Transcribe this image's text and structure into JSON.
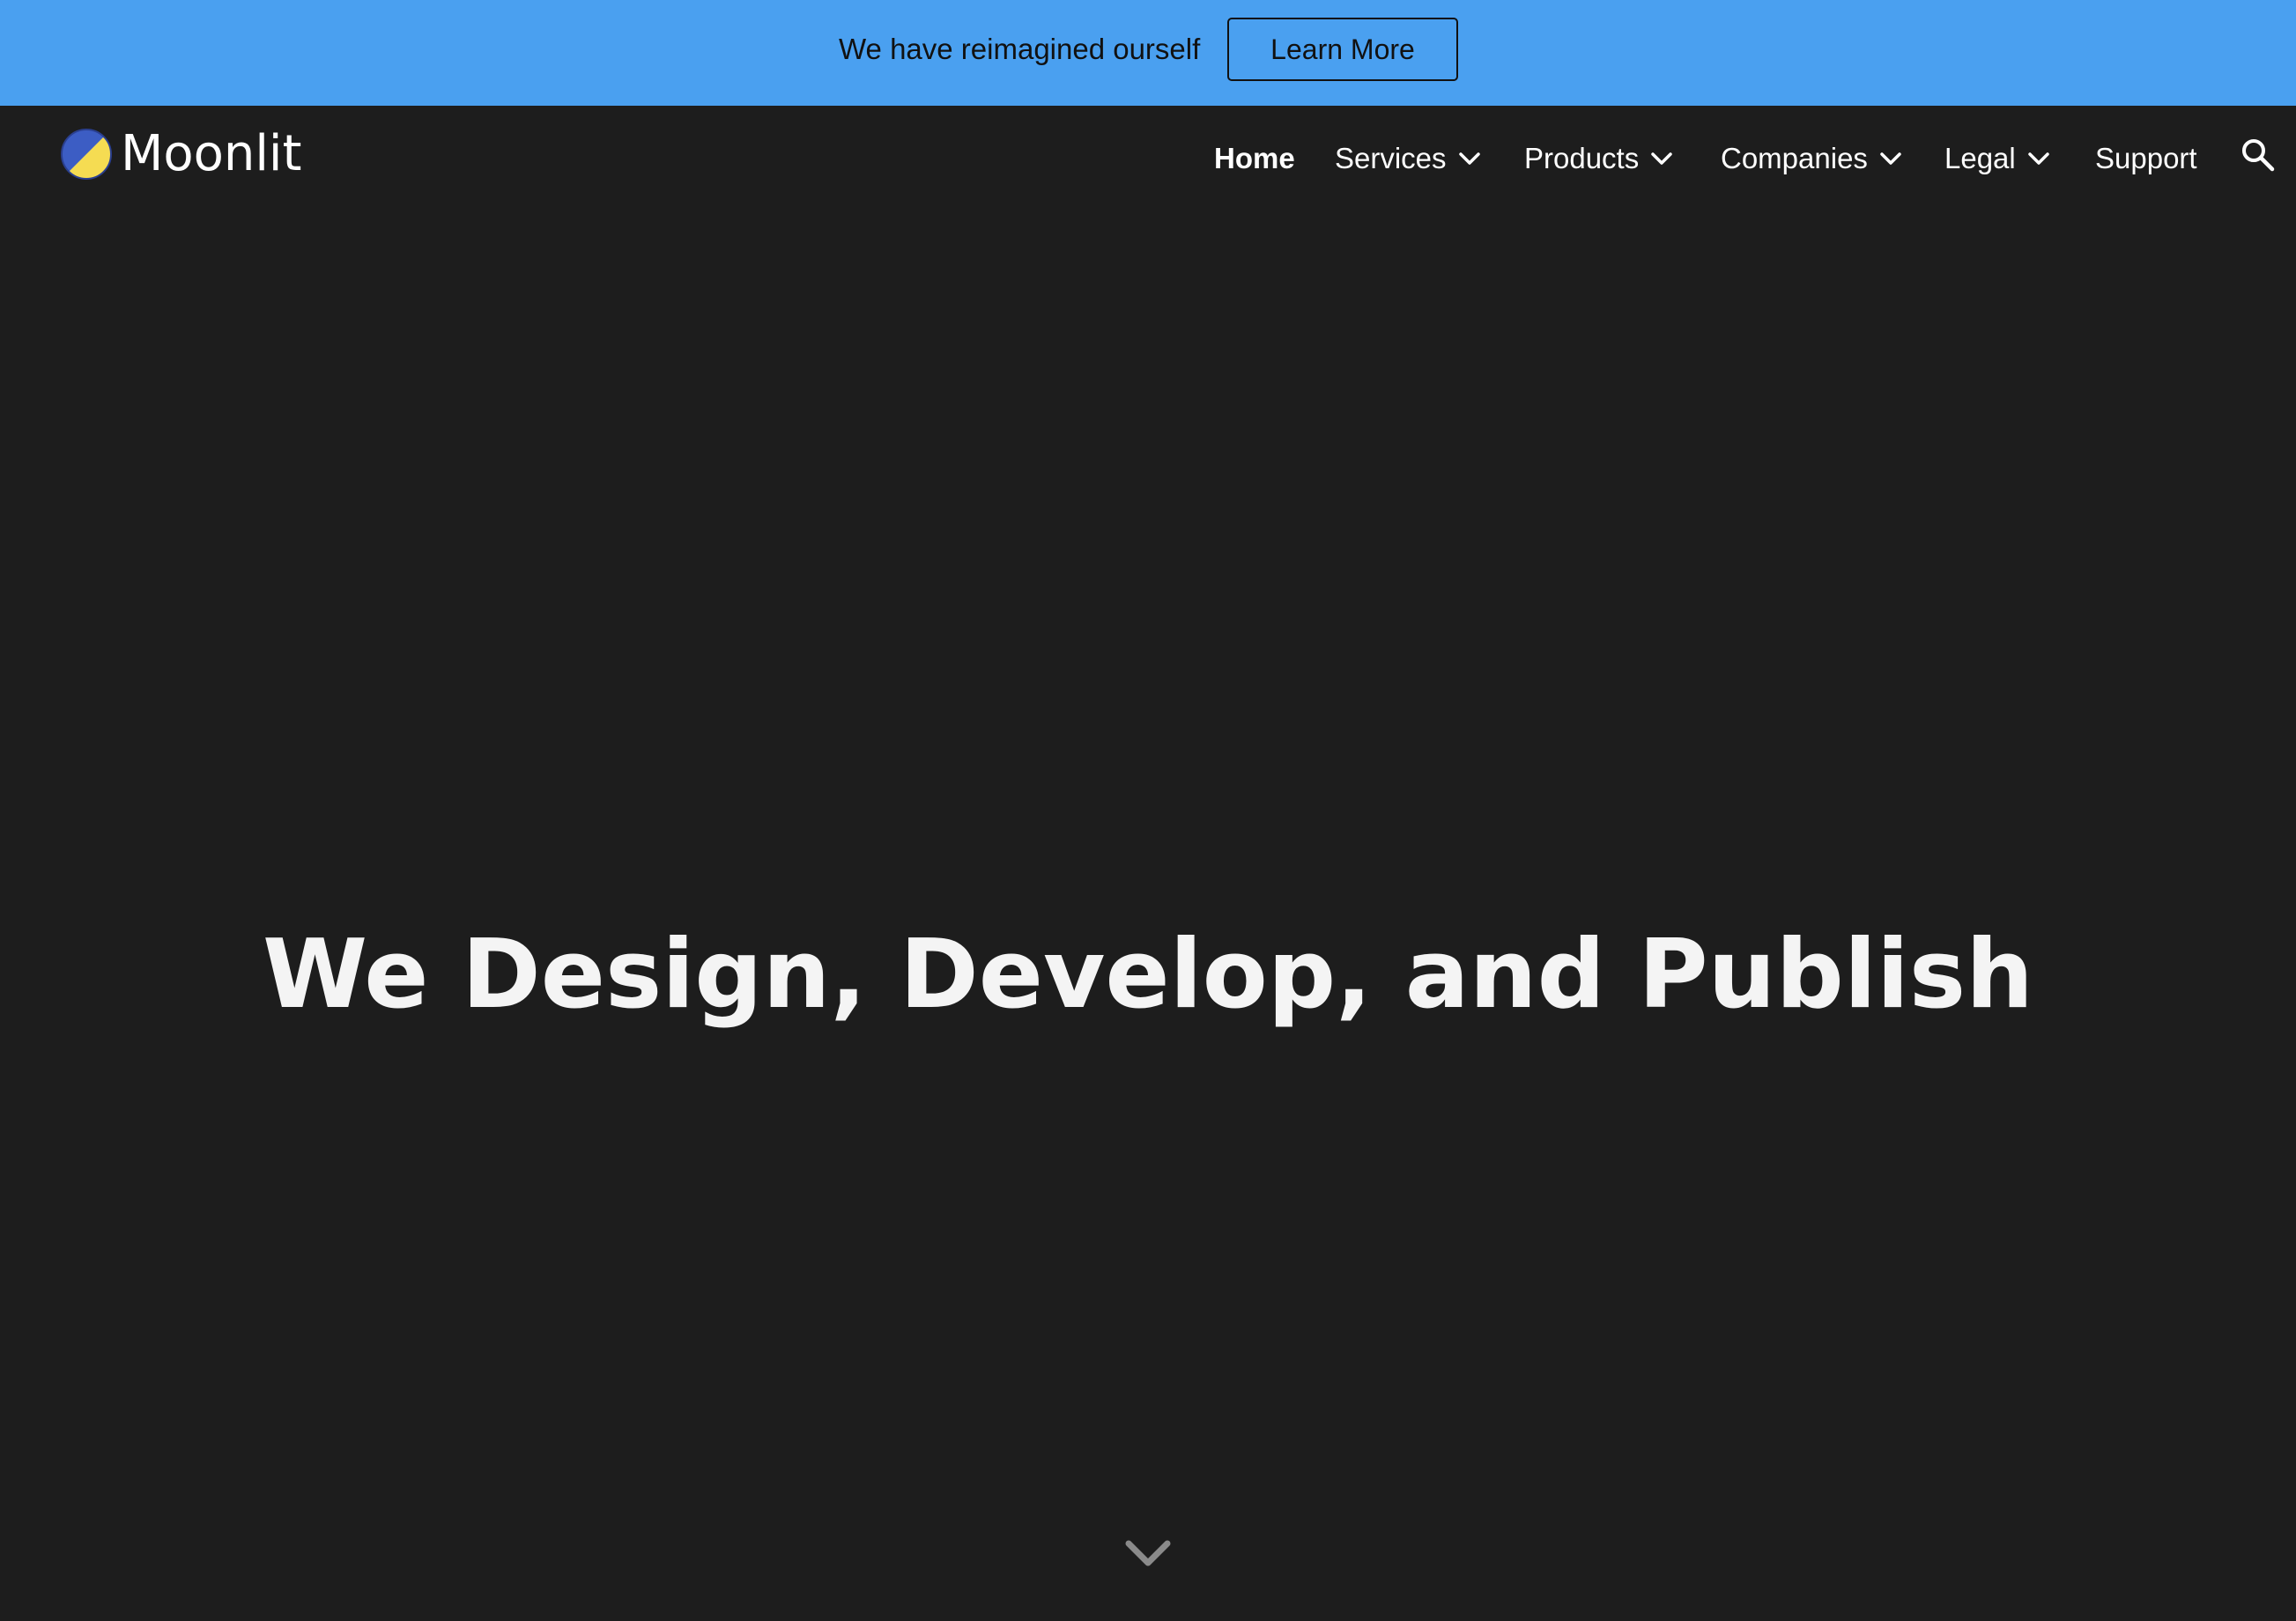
{
  "banner": {
    "text": "We have reimagined ourself",
    "button_label": "Learn More",
    "background_color": "#4aa0f0"
  },
  "header": {
    "logo_text": "Moonlit",
    "logo_colors": [
      "#3c5dc4",
      "#f5dc52"
    ],
    "nav": [
      {
        "label": "Home",
        "active": true,
        "has_dropdown": false
      },
      {
        "label": "Services",
        "active": false,
        "has_dropdown": true
      },
      {
        "label": "Products",
        "active": false,
        "has_dropdown": true
      },
      {
        "label": "Companies",
        "active": false,
        "has_dropdown": true
      },
      {
        "label": "Legal",
        "active": false,
        "has_dropdown": true
      },
      {
        "label": "Support",
        "active": false,
        "has_dropdown": false
      }
    ],
    "search_icon": "search-icon"
  },
  "hero": {
    "title": "We Design, Develop, and Publish",
    "background_color": "#1d1d1d",
    "scroll_icon": "chevron-down-icon"
  }
}
